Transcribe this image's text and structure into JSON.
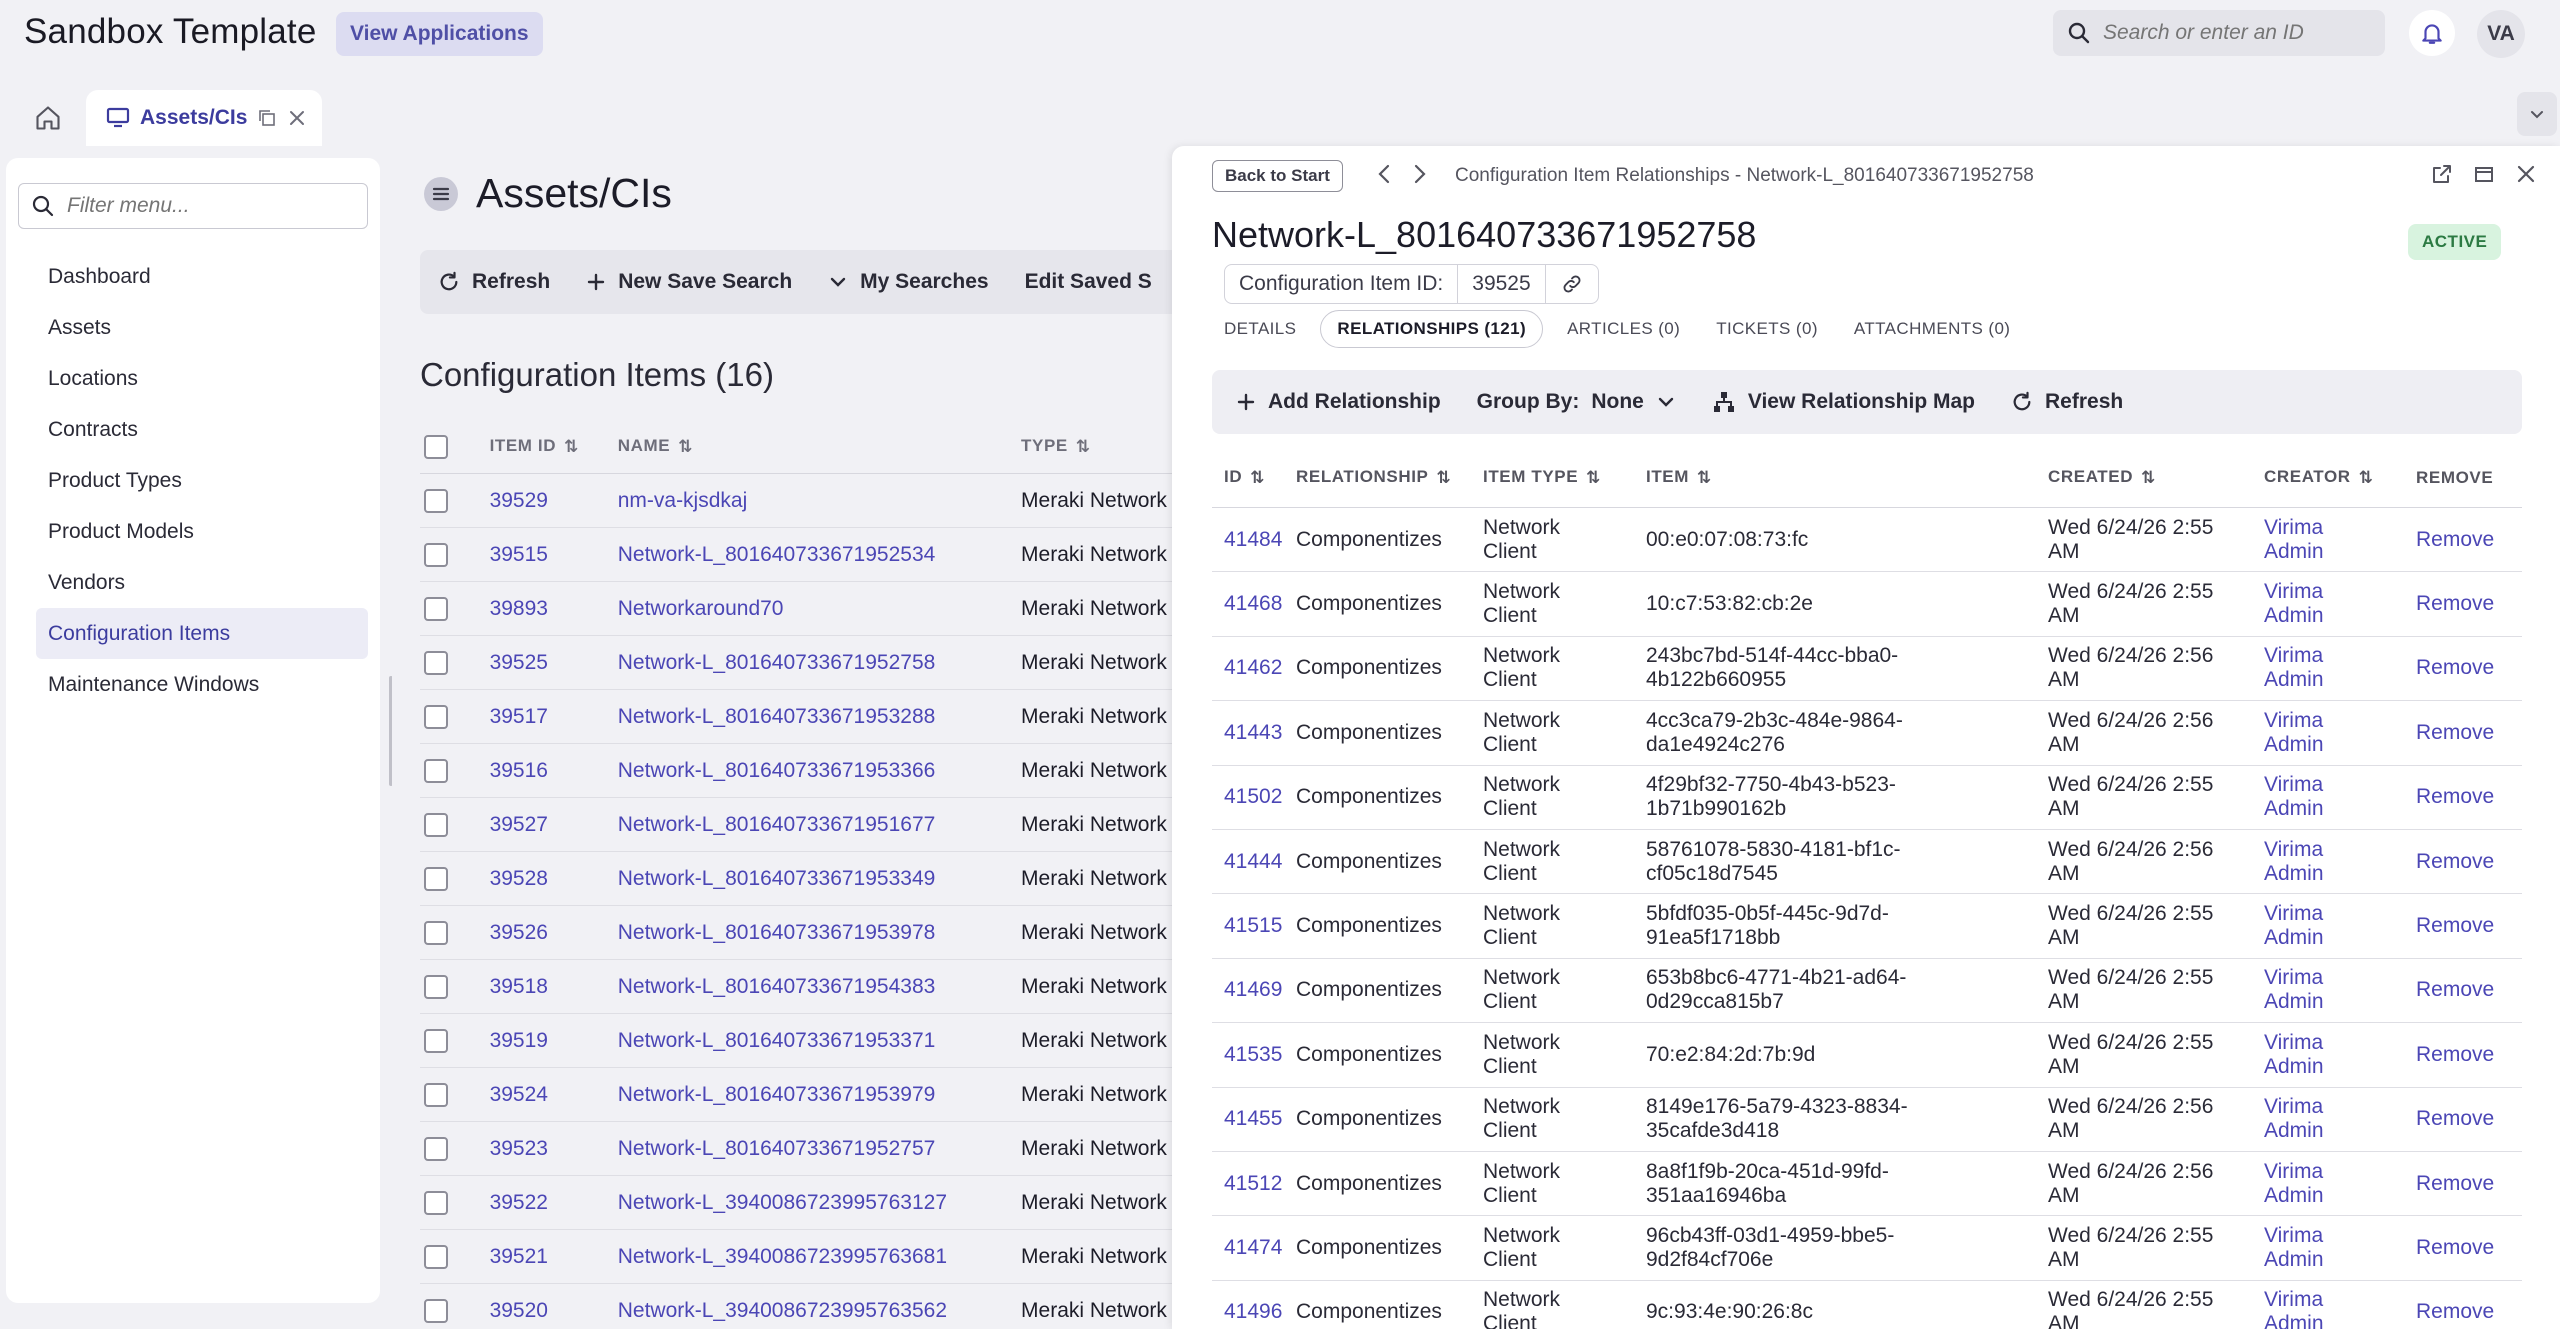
{
  "app": {
    "title": "Sandbox Template",
    "view_applications": "View Applications",
    "search_placeholder": "Search or enter an ID",
    "avatar_initials": "VA"
  },
  "tabs": {
    "current_tab": "Assets/CIs"
  },
  "sidebar": {
    "filter_placeholder": "Filter menu...",
    "items": [
      {
        "label": "Dashboard"
      },
      {
        "label": "Assets"
      },
      {
        "label": "Locations"
      },
      {
        "label": "Contracts"
      },
      {
        "label": "Product Types"
      },
      {
        "label": "Product Models"
      },
      {
        "label": "Vendors"
      },
      {
        "label": "Configuration Items",
        "active": true
      },
      {
        "label": "Maintenance Windows"
      }
    ]
  },
  "main": {
    "title": "Assets/CIs",
    "toolbar": {
      "refresh": "Refresh",
      "new_save_search": "New Save Search",
      "my_searches": "My Searches",
      "edit_saved": "Edit Saved S"
    },
    "section_title": "Configuration Items (16)",
    "columns": [
      "ITEM ID",
      "NAME",
      "TYPE"
    ],
    "rows": [
      {
        "id": "39529",
        "name": "nm-va-kjsdkaj",
        "type": "Meraki Network"
      },
      {
        "id": "39515",
        "name": "Network-L_801640733671952534",
        "type": "Meraki Network"
      },
      {
        "id": "39893",
        "name": "Networkaround70",
        "type": "Meraki Network"
      },
      {
        "id": "39525",
        "name": "Network-L_801640733671952758",
        "type": "Meraki Network"
      },
      {
        "id": "39517",
        "name": "Network-L_801640733671953288",
        "type": "Meraki Network"
      },
      {
        "id": "39516",
        "name": "Network-L_801640733671953366",
        "type": "Meraki Network"
      },
      {
        "id": "39527",
        "name": "Network-L_801640733671951677",
        "type": "Meraki Network"
      },
      {
        "id": "39528",
        "name": "Network-L_801640733671953349",
        "type": "Meraki Network"
      },
      {
        "id": "39526",
        "name": "Network-L_801640733671953978",
        "type": "Meraki Network"
      },
      {
        "id": "39518",
        "name": "Network-L_801640733671954383",
        "type": "Meraki Network"
      },
      {
        "id": "39519",
        "name": "Network-L_801640733671953371",
        "type": "Meraki Network"
      },
      {
        "id": "39524",
        "name": "Network-L_801640733671953979",
        "type": "Meraki Network"
      },
      {
        "id": "39523",
        "name": "Network-L_801640733671952757",
        "type": "Meraki Network"
      },
      {
        "id": "39522",
        "name": "Network-L_3940086723995763127",
        "type": "Meraki Network"
      },
      {
        "id": "39521",
        "name": "Network-L_3940086723995763681",
        "type": "Meraki Network"
      },
      {
        "id": "39520",
        "name": "Network-L_3940086723995763562",
        "type": "Meraki Network"
      }
    ]
  },
  "panel": {
    "back_to_start": "Back to Start",
    "breadcrumb": "Configuration Item Relationships - Network-L_801640733671952758",
    "ci_name": "Network-L_801640733671952758",
    "status": "ACTIVE",
    "ci_id_label": "Configuration Item ID:",
    "ci_id_value": "39525",
    "tabs": [
      {
        "label": "DETAILS"
      },
      {
        "label": "RELATIONSHIPS (121)",
        "active": true
      },
      {
        "label": "ARTICLES (0)"
      },
      {
        "label": "TICKETS (0)"
      },
      {
        "label": "ATTACHMENTS (0)"
      }
    ],
    "toolbar": {
      "add_relationship": "Add Relationship",
      "group_by_label": "Group By:",
      "group_by_value": "None",
      "view_map": "View Relationship Map",
      "refresh": "Refresh"
    },
    "columns": [
      "ID",
      "RELATIONSHIP",
      "ITEM TYPE",
      "ITEM",
      "CREATED",
      "CREATOR",
      "REMOVE"
    ],
    "rows": [
      {
        "id": "41484",
        "relationship": "Componentizes",
        "type1": "Network",
        "type2": "Client",
        "item1": "00:e0:07:08:73:fc",
        "item2": "",
        "created1": "Wed 6/24/26 2:55",
        "created2": "AM",
        "creator1": "Virima",
        "creator2": "Admin",
        "remove": "Remove"
      },
      {
        "id": "41468",
        "relationship": "Componentizes",
        "type1": "Network",
        "type2": "Client",
        "item1": "10:c7:53:82:cb:2e",
        "item2": "",
        "created1": "Wed 6/24/26 2:55",
        "created2": "AM",
        "creator1": "Virima",
        "creator2": "Admin",
        "remove": "Remove"
      },
      {
        "id": "41462",
        "relationship": "Componentizes",
        "type1": "Network",
        "type2": "Client",
        "item1": "243bc7bd-514f-44cc-bba0-",
        "item2": "4b122b660955",
        "created1": "Wed 6/24/26 2:56",
        "created2": "AM",
        "creator1": "Virima",
        "creator2": "Admin",
        "remove": "Remove"
      },
      {
        "id": "41443",
        "relationship": "Componentizes",
        "type1": "Network",
        "type2": "Client",
        "item1": "4cc3ca79-2b3c-484e-9864-",
        "item2": "da1e4924c276",
        "created1": "Wed 6/24/26 2:56",
        "created2": "AM",
        "creator1": "Virima",
        "creator2": "Admin",
        "remove": "Remove"
      },
      {
        "id": "41502",
        "relationship": "Componentizes",
        "type1": "Network",
        "type2": "Client",
        "item1": "4f29bf32-7750-4b43-b523-",
        "item2": "1b71b990162b",
        "created1": "Wed 6/24/26 2:55",
        "created2": "AM",
        "creator1": "Virima",
        "creator2": "Admin",
        "remove": "Remove"
      },
      {
        "id": "41444",
        "relationship": "Componentizes",
        "type1": "Network",
        "type2": "Client",
        "item1": "58761078-5830-4181-bf1c-",
        "item2": "cf05c18d7545",
        "created1": "Wed 6/24/26 2:56",
        "created2": "AM",
        "creator1": "Virima",
        "creator2": "Admin",
        "remove": "Remove"
      },
      {
        "id": "41515",
        "relationship": "Componentizes",
        "type1": "Network",
        "type2": "Client",
        "item1": "5bfdf035-0b5f-445c-9d7d-",
        "item2": "91ea5f1718bb",
        "created1": "Wed 6/24/26 2:55",
        "created2": "AM",
        "creator1": "Virima",
        "creator2": "Admin",
        "remove": "Remove"
      },
      {
        "id": "41469",
        "relationship": "Componentizes",
        "type1": "Network",
        "type2": "Client",
        "item1": "653b8bc6-4771-4b21-ad64-",
        "item2": "0d29cca815b7",
        "created1": "Wed 6/24/26 2:55",
        "created2": "AM",
        "creator1": "Virima",
        "creator2": "Admin",
        "remove": "Remove"
      },
      {
        "id": "41535",
        "relationship": "Componentizes",
        "type1": "Network",
        "type2": "Client",
        "item1": "70:e2:84:2d:7b:9d",
        "item2": "",
        "created1": "Wed 6/24/26 2:55",
        "created2": "AM",
        "creator1": "Virima",
        "creator2": "Admin",
        "remove": "Remove"
      },
      {
        "id": "41455",
        "relationship": "Componentizes",
        "type1": "Network",
        "type2": "Client",
        "item1": "8149e176-5a79-4323-8834-",
        "item2": "35cafde3d418",
        "created1": "Wed 6/24/26 2:56",
        "created2": "AM",
        "creator1": "Virima",
        "creator2": "Admin",
        "remove": "Remove"
      },
      {
        "id": "41512",
        "relationship": "Componentizes",
        "type1": "Network",
        "type2": "Client",
        "item1": "8a8f1f9b-20ca-451d-99fd-",
        "item2": "351aa16946ba",
        "created1": "Wed 6/24/26 2:56",
        "created2": "AM",
        "creator1": "Virima",
        "creator2": "Admin",
        "remove": "Remove"
      },
      {
        "id": "41474",
        "relationship": "Componentizes",
        "type1": "Network",
        "type2": "Client",
        "item1": "96cb43ff-03d1-4959-bbe5-",
        "item2": "9d2f84cf706e",
        "created1": "Wed 6/24/26 2:55",
        "created2": "AM",
        "creator1": "Virima",
        "creator2": "Admin",
        "remove": "Remove"
      },
      {
        "id": "41496",
        "relationship": "Componentizes",
        "type1": "Network",
        "type2": "Client",
        "item1": "9c:93:4e:90:26:8c",
        "item2": "",
        "created1": "Wed 6/24/26 2:55",
        "created2": "AM",
        "creator1": "Virima",
        "creator2": "Admin",
        "remove": "Remove"
      }
    ]
  },
  "colors": {
    "accent": "#4b46b5",
    "active_bg": "#d8f3df",
    "active_text": "#2c7a43"
  }
}
